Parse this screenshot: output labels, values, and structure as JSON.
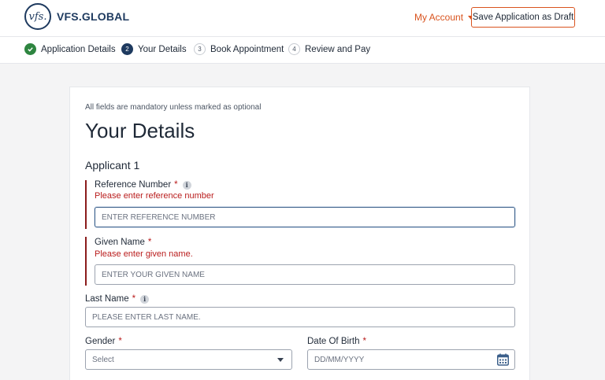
{
  "header": {
    "logo_mark": "vfs.",
    "logo_text": "VFS.GLOBAL",
    "account_label": "My Account",
    "save_draft_label": "Save Application as Draft"
  },
  "steps": [
    {
      "num": "",
      "label": "Application Details",
      "state": "done"
    },
    {
      "num": "2",
      "label": "Your Details",
      "state": "active"
    },
    {
      "num": "3",
      "label": "Book Appointment",
      "state": "todo"
    },
    {
      "num": "4",
      "label": "Review and Pay",
      "state": "todo"
    }
  ],
  "form": {
    "mandatory_note": "All fields are mandatory unless marked as optional",
    "title": "Your Details",
    "applicant_heading": "Applicant 1",
    "reference": {
      "label": "Reference Number",
      "error": "Please enter reference number",
      "placeholder": "ENTER REFERENCE NUMBER"
    },
    "given_name": {
      "label": "Given Name",
      "error": "Please enter given name.",
      "placeholder": "ENTER YOUR GIVEN NAME"
    },
    "last_name": {
      "label": "Last Name",
      "placeholder": "PLEASE ENTER LAST NAME."
    },
    "gender": {
      "label": "Gender",
      "selected": "Select"
    },
    "dob": {
      "label": "Date Of Birth",
      "placeholder": "DD/MM/YYYY"
    },
    "required_mark": "*",
    "info_glyph": "i"
  },
  "colors": {
    "brand": "#1e3a5f",
    "accent": "#d9531e",
    "error": "#b91c1c",
    "success": "#2e8540"
  }
}
